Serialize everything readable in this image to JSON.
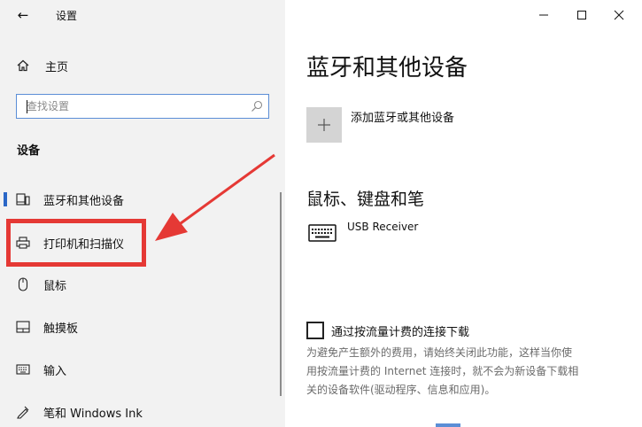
{
  "app": {
    "title": "设置",
    "back_glyph": "←"
  },
  "sidebar": {
    "home_label": "主页",
    "search": {
      "placeholder": "查找设置"
    },
    "section_title": "设备",
    "items": [
      {
        "label": "蓝牙和其他设备",
        "icon": "bluetooth-devices-icon",
        "selected": true
      },
      {
        "label": "打印机和扫描仪",
        "icon": "printer-icon",
        "selected": false
      },
      {
        "label": "鼠标",
        "icon": "mouse-icon",
        "selected": false
      },
      {
        "label": "触摸板",
        "icon": "touchpad-icon",
        "selected": false
      },
      {
        "label": "输入",
        "icon": "keyboard-icon",
        "selected": false
      },
      {
        "label": "笔和 Windows Ink",
        "icon": "pen-icon",
        "selected": false
      }
    ]
  },
  "annotation": {
    "color": "#e53935"
  },
  "window_controls": [
    "minimize",
    "maximize",
    "close"
  ],
  "main": {
    "title": "蓝牙和其他设备",
    "add_device_label": "添加蓝牙或其他设备",
    "mouse_keyboard_pen_title": "鼠标、键盘和笔",
    "devices": [
      {
        "name": "USB Receiver",
        "icon": "keyboard-icon"
      }
    ],
    "metered_checkbox": {
      "label": "通过按流量计费的连接下载",
      "checked": false
    },
    "metered_description_lines": [
      "为避免产生额外的费用，请始终关闭此功能，这样当你使",
      "用按流量计费的 Internet 连接时，就不会为新设备下载相",
      "关的设备软件(驱动程序、信息和应用)。"
    ]
  },
  "colors": {
    "sidebar_bg": "#f2f2f2",
    "accent": "#2b67c7",
    "annotation_red": "#e53935",
    "tile_gray": "#d4d4d4",
    "description_text": "#6b6b6b"
  }
}
